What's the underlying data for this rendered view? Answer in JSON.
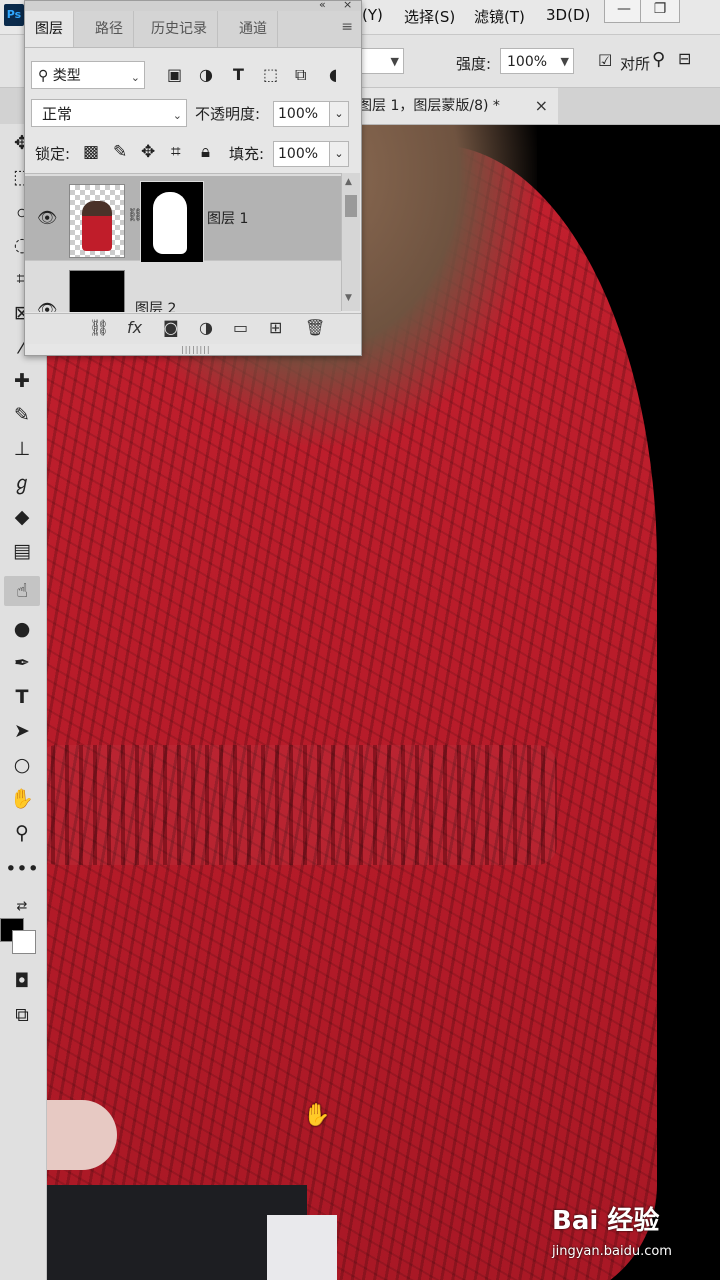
{
  "app": {
    "logo": "Ps"
  },
  "menu": {
    "items": [
      "(Y)",
      "选择(S)",
      "滤镜(T)",
      "3D(D)"
    ]
  },
  "window_controls": {
    "minimize": "—",
    "restore": "❐"
  },
  "options_bar": {
    "strength_label": "强度:",
    "strength_value": "100%",
    "sample_label": "对所",
    "search_icon": "search-icon"
  },
  "document_tab": {
    "title": "图层 1，图层蒙版/8) *",
    "close": "×"
  },
  "layers_panel": {
    "collapse": "«",
    "close": "×",
    "tabs": [
      "图层",
      "路径",
      "历史记录",
      "通道"
    ],
    "active_tab": 0,
    "filter_kind": "类型",
    "blend_mode": "正常",
    "opacity_label": "不透明度:",
    "opacity_value": "100%",
    "lock_label": "锁定:",
    "fill_label": "填充:",
    "fill_value": "100%",
    "layers": [
      {
        "name": "图层 1",
        "visible": true,
        "selected": true,
        "has_mask": true
      },
      {
        "name": "图层 2",
        "visible": true,
        "selected": false,
        "has_mask": false
      }
    ],
    "fx_label": "fx"
  },
  "watermark": {
    "brand": "Bai 经验",
    "url": "jingyan.baidu.com"
  }
}
